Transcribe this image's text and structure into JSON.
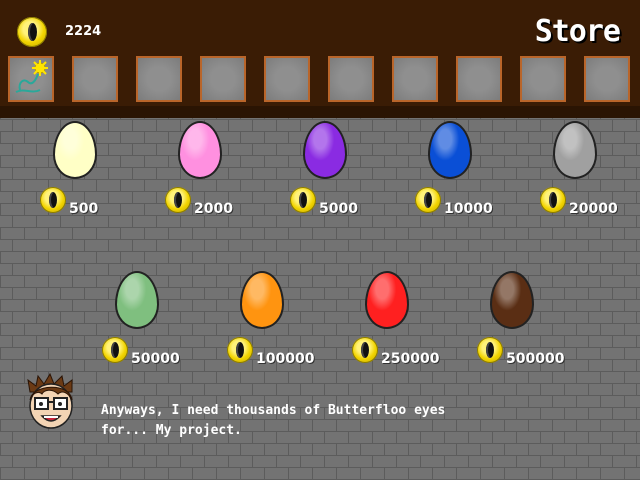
{
  "header": {
    "money": "2224",
    "title": "Store"
  },
  "inventory": {
    "slots": [
      {
        "item": "butterfly-flower",
        "filled": true
      },
      {
        "item": "",
        "filled": false
      },
      {
        "item": "",
        "filled": false
      },
      {
        "item": "",
        "filled": false
      },
      {
        "item": "",
        "filled": false
      },
      {
        "item": "",
        "filled": false
      },
      {
        "item": "",
        "filled": false
      },
      {
        "item": "",
        "filled": false
      },
      {
        "item": "",
        "filled": false
      },
      {
        "item": "",
        "filled": false
      }
    ]
  },
  "eggs": [
    {
      "color": "#ffffc6",
      "price": "500"
    },
    {
      "color": "#ff90e0",
      "price": "2000"
    },
    {
      "color": "#8a2be2",
      "price": "5000"
    },
    {
      "color": "#0a4fd6",
      "price": "10000"
    },
    {
      "color": "#a0a0a0",
      "price": "20000"
    },
    {
      "color": "#7fbf7f",
      "price": "50000"
    },
    {
      "color": "#ff9410",
      "price": "100000"
    },
    {
      "color": "#ff2020",
      "price": "250000"
    },
    {
      "color": "#5a2e14",
      "price": "500000"
    }
  ],
  "dialog": {
    "line1": "Anyways, I need thousands of Butterfloo eyes",
    "line2": "for... My project."
  }
}
